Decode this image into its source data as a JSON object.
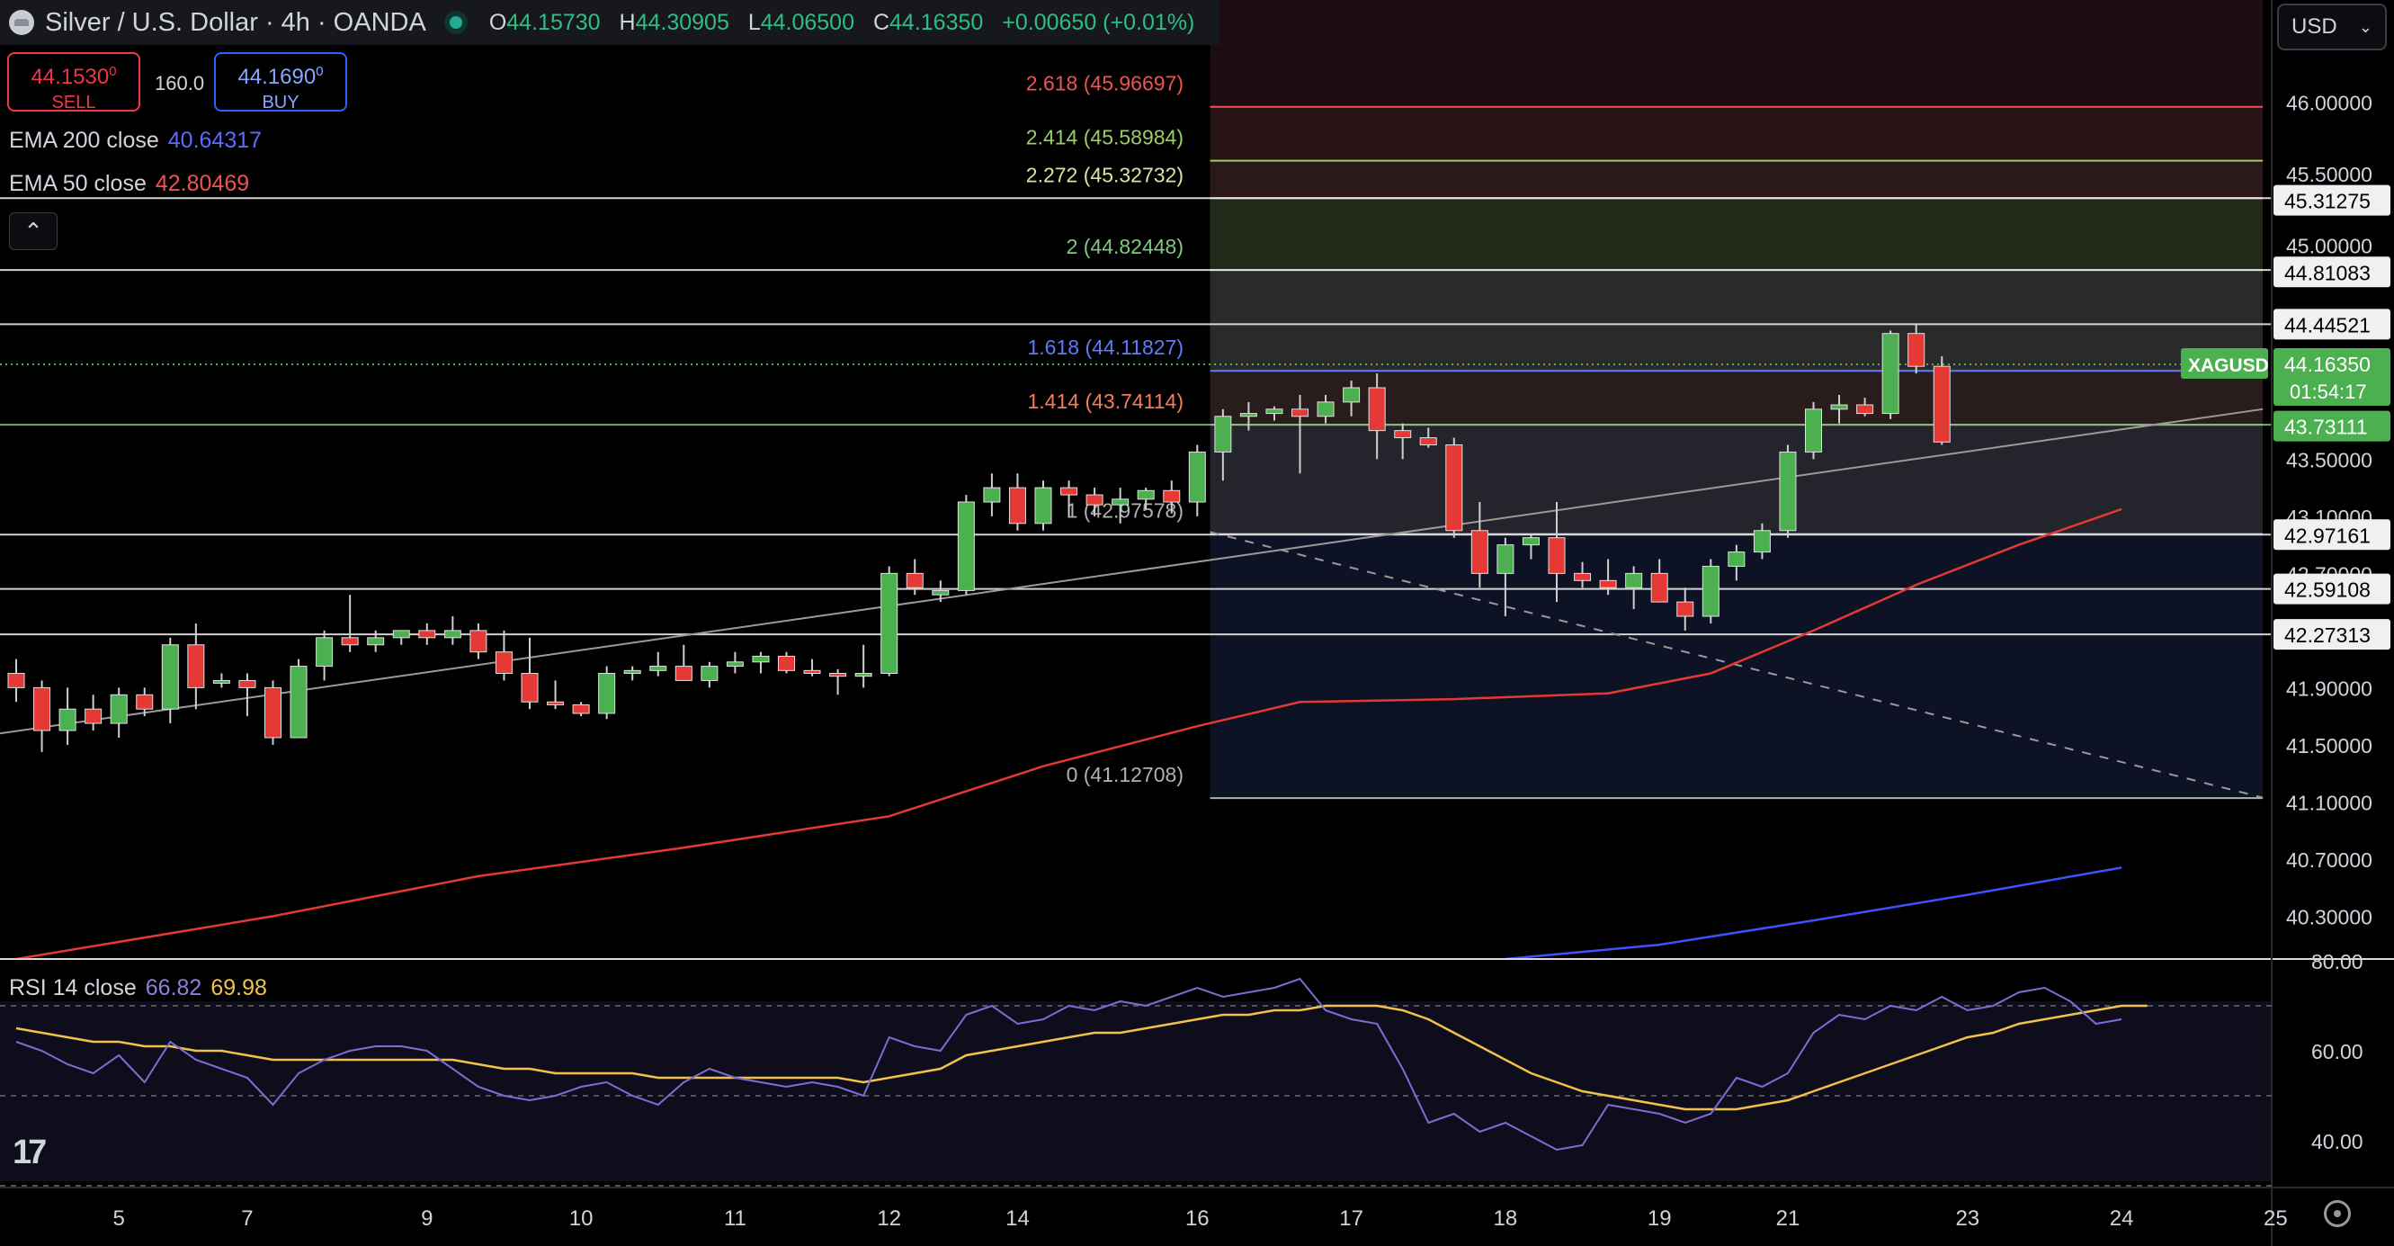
{
  "header": {
    "symbol": "Silver / U.S. Dollar · 4h · OANDA",
    "ohlc": [
      {
        "k": "O",
        "v": "44.15730"
      },
      {
        "k": "H",
        "v": "44.30905"
      },
      {
        "k": "L",
        "v": "44.06500"
      },
      {
        "k": "C",
        "v": "44.16350"
      },
      {
        "k": "",
        "v": "+0.00650 (+0.01%)"
      }
    ]
  },
  "trade": {
    "sell_price": "44.1530",
    "sell_sup": "0",
    "sell_label": "SELL",
    "buy_price": "44.1690",
    "buy_sup": "0",
    "buy_label": "BUY",
    "spread": "160.0"
  },
  "indicators": {
    "ema200_label": "EMA 200 close",
    "ema200_value": "40.64317",
    "ema50_label": "EMA 50 close",
    "ema50_value": "42.80469",
    "rsi_label": "RSI 14 close",
    "rsi_value": "66.82",
    "rsi_ma_value": "69.98"
  },
  "currency": "USD",
  "colors": {
    "up": "#4caf50",
    "down": "#e53935",
    "ema50": "#e53935",
    "ema200": "#3f51ff",
    "rsi": "#7e6cd4",
    "rsi_ma": "#f0c24a"
  },
  "chart_data": {
    "type": "candlestick",
    "x_ticks": [
      {
        "label": "5",
        "index": 4
      },
      {
        "label": "7",
        "index": 9
      },
      {
        "label": "9",
        "index": 16
      },
      {
        "label": "10",
        "index": 22
      },
      {
        "label": "11",
        "index": 28
      },
      {
        "label": "12",
        "index": 34
      },
      {
        "label": "14",
        "index": 39
      },
      {
        "label": "16",
        "index": 46
      },
      {
        "label": "17",
        "index": 52
      },
      {
        "label": "18",
        "index": 58
      },
      {
        "label": "19",
        "index": 64
      },
      {
        "label": "21",
        "index": 69
      },
      {
        "label": "23",
        "index": 76
      },
      {
        "label": "24",
        "index": 82
      },
      {
        "label": "25",
        "index": 88
      }
    ],
    "y_ticks": [
      46.0,
      45.5,
      45.0,
      43.5,
      43.1,
      42.7,
      41.9,
      41.5,
      41.1,
      40.7,
      40.3
    ],
    "y_tick_labels": [
      "46.00000",
      "45.50000",
      "45.00000",
      "43.50000",
      "43.10000",
      "42.70000",
      "41.90000",
      "41.50000",
      "41.10000",
      "40.70000",
      "40.30000"
    ],
    "ylim": [
      40.0,
      46.4
    ],
    "price_tags": [
      {
        "label": "45.31275",
        "value": 45.31275
      },
      {
        "label": "44.81083",
        "value": 44.81083
      },
      {
        "label": "44.44521",
        "value": 44.44521
      },
      {
        "label": "42.97161",
        "value": 42.97161
      },
      {
        "label": "42.59108",
        "value": 42.59108
      },
      {
        "label": "42.27313",
        "value": 42.27313
      }
    ],
    "current": {
      "symbol": "XAGUSD",
      "price": "44.16350",
      "value": 44.1635,
      "countdown": "01:54:17"
    },
    "fib_low_tag": {
      "label": "43.73111",
      "value": 43.73111
    },
    "fib_levels": [
      {
        "label": "2.618 (45.96697)",
        "value": 45.96697,
        "color": "#ef5350",
        "fill": "#2a1418"
      },
      {
        "label": "2.414 (45.58984)",
        "value": 45.58984,
        "color": "#9ccc65",
        "fill": "#2d1a1a"
      },
      {
        "label": "2.272 (45.32732)",
        "value": 45.32732,
        "color": "#e0e0a0",
        "fill": "#242b1a"
      },
      {
        "label": "2 (44.82448)",
        "value": 44.82448,
        "color": "#81c784",
        "fill": "#2c2c2c"
      },
      {
        "label": "1.618 (44.11827)",
        "value": 44.11827,
        "color": "#5c7cfa",
        "fill": "#2a1e1e"
      },
      {
        "label": "1.414 (43.74114)",
        "value": 43.74114,
        "color": "#f57c5b",
        "fill": "#26262e"
      },
      {
        "label": "1 (42.97578)",
        "value": 42.97578,
        "color": "#b0b0b0",
        "fill": "#0e1426"
      },
      {
        "label": "0 (41.12708)",
        "value": 41.12708,
        "color": "#b0b0b0",
        "fill": "#121212"
      }
    ],
    "horizontal_lines": [
      45.32732,
      44.82448,
      44.44521,
      43.74114,
      42.97161,
      42.59108,
      42.27313
    ],
    "trendline": {
      "from": {
        "index": -1,
        "value": 41.57
      },
      "to": {
        "index": 87.5,
        "value": 43.85
      }
    },
    "dashed_trendline": {
      "from": {
        "index": 46.5,
        "value": 42.99
      },
      "to": {
        "index": 87.5,
        "value": 41.13
      }
    },
    "candles": [
      [
        42.0,
        42.1,
        41.8,
        41.9
      ],
      [
        41.9,
        41.95,
        41.45,
        41.6
      ],
      [
        41.6,
        41.9,
        41.5,
        41.75
      ],
      [
        41.75,
        41.85,
        41.6,
        41.65
      ],
      [
        41.65,
        41.9,
        41.55,
        41.85
      ],
      [
        41.85,
        41.9,
        41.7,
        41.75
      ],
      [
        41.75,
        42.25,
        41.65,
        42.2
      ],
      [
        42.2,
        42.35,
        41.75,
        41.9
      ],
      [
        41.95,
        42.0,
        41.9,
        41.95
      ],
      [
        41.95,
        42.0,
        41.7,
        41.9
      ],
      [
        41.9,
        41.95,
        41.5,
        41.55
      ],
      [
        41.55,
        42.1,
        41.55,
        42.05
      ],
      [
        42.05,
        42.3,
        41.95,
        42.25
      ],
      [
        42.25,
        42.55,
        42.15,
        42.2
      ],
      [
        42.2,
        42.3,
        42.15,
        42.25
      ],
      [
        42.25,
        42.3,
        42.2,
        42.3
      ],
      [
        42.3,
        42.35,
        42.2,
        42.25
      ],
      [
        42.25,
        42.4,
        42.2,
        42.3
      ],
      [
        42.3,
        42.35,
        42.1,
        42.15
      ],
      [
        42.15,
        42.3,
        41.95,
        42.0
      ],
      [
        42.0,
        42.25,
        41.75,
        41.8
      ],
      [
        41.8,
        41.95,
        41.75,
        41.78
      ],
      [
        41.78,
        41.8,
        41.7,
        41.72
      ],
      [
        41.72,
        42.05,
        41.68,
        42.0
      ],
      [
        42.0,
        42.05,
        41.95,
        42.02
      ],
      [
        42.02,
        42.15,
        41.98,
        42.05
      ],
      [
        42.05,
        42.2,
        42.0,
        41.95
      ],
      [
        41.95,
        42.08,
        41.9,
        42.05
      ],
      [
        42.05,
        42.15,
        42.0,
        42.08
      ],
      [
        42.08,
        42.15,
        42.0,
        42.12
      ],
      [
        42.12,
        42.15,
        42.0,
        42.02
      ],
      [
        42.02,
        42.1,
        41.98,
        42.0
      ],
      [
        42.0,
        42.03,
        41.85,
        41.98
      ],
      [
        41.98,
        42.2,
        41.9,
        42.0
      ],
      [
        42.0,
        42.75,
        41.98,
        42.7
      ],
      [
        42.7,
        42.8,
        42.55,
        42.6
      ],
      [
        42.55,
        42.65,
        42.5,
        42.58
      ],
      [
        42.58,
        43.25,
        42.55,
        43.2
      ],
      [
        43.2,
        43.4,
        43.1,
        43.3
      ],
      [
        43.3,
        43.4,
        43.0,
        43.05
      ],
      [
        43.05,
        43.35,
        43.0,
        43.3
      ],
      [
        43.3,
        43.35,
        43.1,
        43.25
      ],
      [
        43.25,
        43.3,
        43.1,
        43.18
      ],
      [
        43.18,
        43.3,
        43.05,
        43.22
      ],
      [
        43.22,
        43.3,
        43.15,
        43.28
      ],
      [
        43.28,
        43.35,
        43.12,
        43.2
      ],
      [
        43.2,
        43.6,
        43.1,
        43.55
      ],
      [
        43.55,
        43.85,
        43.35,
        43.8
      ],
      [
        43.8,
        43.9,
        43.7,
        43.82
      ],
      [
        43.82,
        43.87,
        43.77,
        43.85
      ],
      [
        43.85,
        43.95,
        43.4,
        43.8
      ],
      [
        43.8,
        43.95,
        43.75,
        43.9
      ],
      [
        43.9,
        44.05,
        43.8,
        44.0
      ],
      [
        44.0,
        44.1,
        43.5,
        43.7
      ],
      [
        43.7,
        43.75,
        43.5,
        43.65
      ],
      [
        43.65,
        43.72,
        43.58,
        43.6
      ],
      [
        43.6,
        43.65,
        42.95,
        43.0
      ],
      [
        43.0,
        43.2,
        42.6,
        42.7
      ],
      [
        42.7,
        42.95,
        42.4,
        42.9
      ],
      [
        42.9,
        42.98,
        42.8,
        42.95
      ],
      [
        42.95,
        43.2,
        42.5,
        42.7
      ],
      [
        42.7,
        42.78,
        42.6,
        42.65
      ],
      [
        42.65,
        42.8,
        42.55,
        42.6
      ],
      [
        42.6,
        42.75,
        42.45,
        42.7
      ],
      [
        42.7,
        42.8,
        42.5,
        42.5
      ],
      [
        42.5,
        42.6,
        42.3,
        42.4
      ],
      [
        42.4,
        42.8,
        42.35,
        42.75
      ],
      [
        42.75,
        42.9,
        42.65,
        42.85
      ],
      [
        42.85,
        43.05,
        42.8,
        43.0
      ],
      [
        43.0,
        43.6,
        42.95,
        43.55
      ],
      [
        43.55,
        43.9,
        43.5,
        43.85
      ],
      [
        43.85,
        43.95,
        43.75,
        43.88
      ],
      [
        43.88,
        43.93,
        43.8,
        43.82
      ],
      [
        43.82,
        44.4,
        43.78,
        44.38
      ],
      [
        44.38,
        44.45,
        44.1,
        44.15
      ],
      [
        44.15,
        44.22,
        43.6,
        43.62
      ]
    ],
    "ema50": [
      {
        "index": 0,
        "value": 40.0
      },
      {
        "index": 10,
        "value": 40.3
      },
      {
        "index": 18,
        "value": 40.58
      },
      {
        "index": 26,
        "value": 40.78
      },
      {
        "index": 34,
        "value": 41.0
      },
      {
        "index": 40,
        "value": 41.35
      },
      {
        "index": 46,
        "value": 41.63
      },
      {
        "index": 50,
        "value": 41.8
      },
      {
        "index": 56,
        "value": 41.82
      },
      {
        "index": 62,
        "value": 41.86
      },
      {
        "index": 66,
        "value": 42.0
      },
      {
        "index": 70,
        "value": 42.3
      },
      {
        "index": 74,
        "value": 42.62
      },
      {
        "index": 78,
        "value": 42.9
      },
      {
        "index": 82,
        "value": 43.15
      }
    ],
    "ema200": [
      {
        "index": 58,
        "value": 40.0
      },
      {
        "index": 64,
        "value": 40.1
      },
      {
        "index": 70,
        "value": 40.27
      },
      {
        "index": 76,
        "value": 40.45
      },
      {
        "index": 82,
        "value": 40.64
      }
    ],
    "rsi": {
      "ylim": [
        30,
        80
      ],
      "y_tick_labels": [
        "80.00",
        "60.00",
        "40.00"
      ],
      "y_ticks": [
        80,
        60,
        40
      ],
      "bands": [
        70,
        50,
        30
      ],
      "values": [
        62,
        60,
        57,
        55,
        59,
        53,
        62,
        58,
        56,
        54,
        48,
        55,
        58,
        60,
        61,
        61,
        60,
        56,
        52,
        50,
        49,
        50,
        52,
        53,
        50,
        48,
        53,
        56,
        54,
        53,
        52,
        53,
        52,
        50,
        63,
        61,
        60,
        68,
        70,
        66,
        67,
        70,
        69,
        71,
        70,
        72,
        74,
        72,
        73,
        74,
        76,
        69,
        67,
        66,
        56,
        44,
        46,
        42,
        44,
        41,
        38,
        39,
        48,
        47,
        46,
        44,
        46,
        54,
        52,
        55,
        64,
        68,
        67,
        70,
        69,
        72,
        69,
        70,
        73,
        74,
        71,
        66,
        67
      ],
      "ma_values": [
        65,
        64,
        63,
        62,
        62,
        61,
        61,
        60,
        60,
        59,
        58,
        58,
        58,
        58,
        58,
        58,
        58,
        58,
        57,
        56,
        56,
        55,
        55,
        55,
        55,
        54,
        54,
        54,
        54,
        54,
        54,
        54,
        54,
        53,
        54,
        55,
        56,
        59,
        60,
        61,
        62,
        63,
        64,
        64,
        65,
        66,
        67,
        68,
        68,
        69,
        69,
        70,
        70,
        70,
        69,
        67,
        64,
        61,
        58,
        55,
        53,
        51,
        50,
        49,
        48,
        47,
        47,
        47,
        48,
        49,
        51,
        53,
        55,
        57,
        59,
        61,
        63,
        64,
        66,
        67,
        68,
        69,
        70,
        70
      ]
    }
  }
}
